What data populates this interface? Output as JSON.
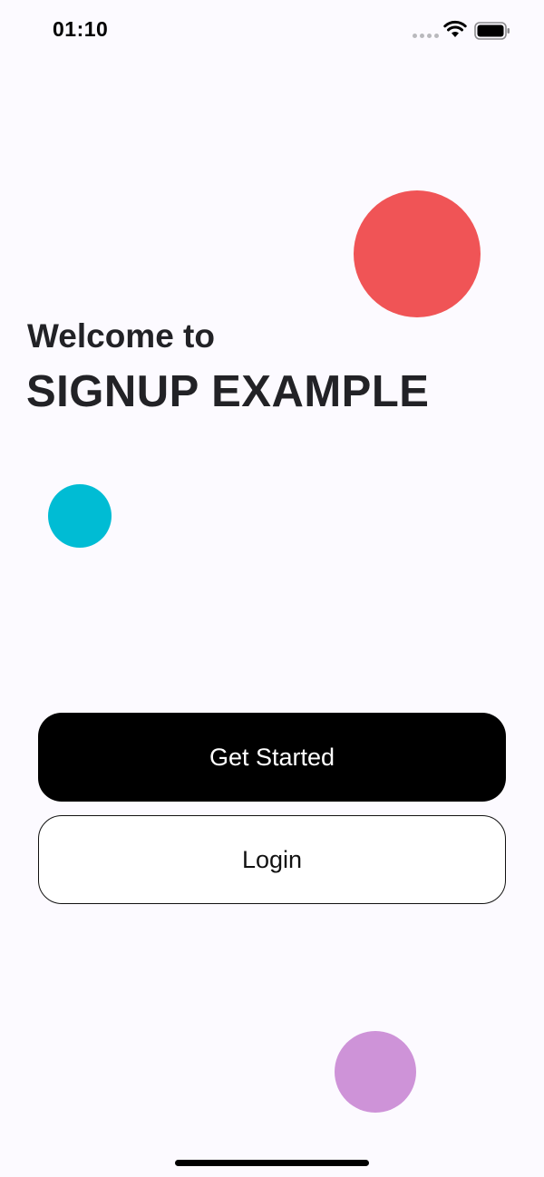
{
  "status_bar": {
    "time": "01:10",
    "icons": [
      "signal-dots-icon",
      "wifi-icon",
      "battery-icon"
    ]
  },
  "welcome": {
    "greeting": "Welcome to",
    "app_name": "SIGNUP EXAMPLE"
  },
  "buttons": {
    "get_started": "Get Started",
    "login": "Login"
  },
  "colors": {
    "background": "#fcfaff",
    "red_circle": "#f05456",
    "teal_circle": "#00bcd4",
    "purple_circle": "#ce93d8",
    "primary_button": "#000000",
    "text": "#222226"
  }
}
